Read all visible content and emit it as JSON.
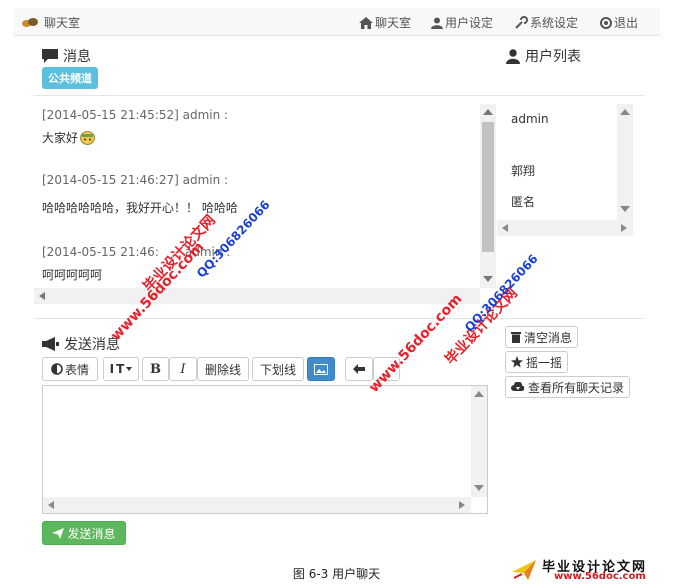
{
  "nav": {
    "brand": "聊天室",
    "items": [
      {
        "label": "聊天室",
        "icon": "home-icon"
      },
      {
        "label": "用户设定",
        "icon": "user-icon"
      },
      {
        "label": "系统设定",
        "icon": "wrench-icon"
      },
      {
        "label": "退出",
        "icon": "power-icon"
      }
    ]
  },
  "messages_panel": {
    "title": "消息",
    "channel_badge": "公共频道",
    "messages": [
      {
        "header": "[2014-05-15 21:45:52] admin :",
        "text": "大家好"
      },
      {
        "header": "[2014-05-15 21:46:27] admin :",
        "text": "哈哈哈哈哈哈，我好开心！！ 哈哈哈"
      },
      {
        "header": "[2014-05-15 21:46:",
        "header_tail": "admin :",
        "text": "呵呵呵呵呵"
      }
    ]
  },
  "users_panel": {
    "title": "用户列表",
    "users": [
      "admin",
      "郭翔",
      "匿名"
    ]
  },
  "send_panel": {
    "title": "发送消息",
    "toolbar": {
      "emoji": "表情",
      "font_size": "T",
      "bold": "B",
      "italic": "I",
      "strikethrough": "删除线",
      "underline": "下划线"
    },
    "send_button": "发送消息"
  },
  "side_actions": {
    "clear": "清空消息",
    "shake": "摇一摇",
    "history": "查看所有聊天记录"
  },
  "watermarks": {
    "url": "www.56doc.com",
    "qq": "QQ:306826066",
    "site_name": "毕业设计论文网"
  },
  "caption": "图 6-3  用户聊天",
  "footer_logo": {
    "title": "毕业设计论文网",
    "url": "www.56doc.com"
  },
  "colors": {
    "badge": "#5bc0de",
    "primary": "#428bca",
    "success": "#5cb85c",
    "watermark_red": "#e8202a",
    "watermark_blue": "#1a3fd6"
  }
}
